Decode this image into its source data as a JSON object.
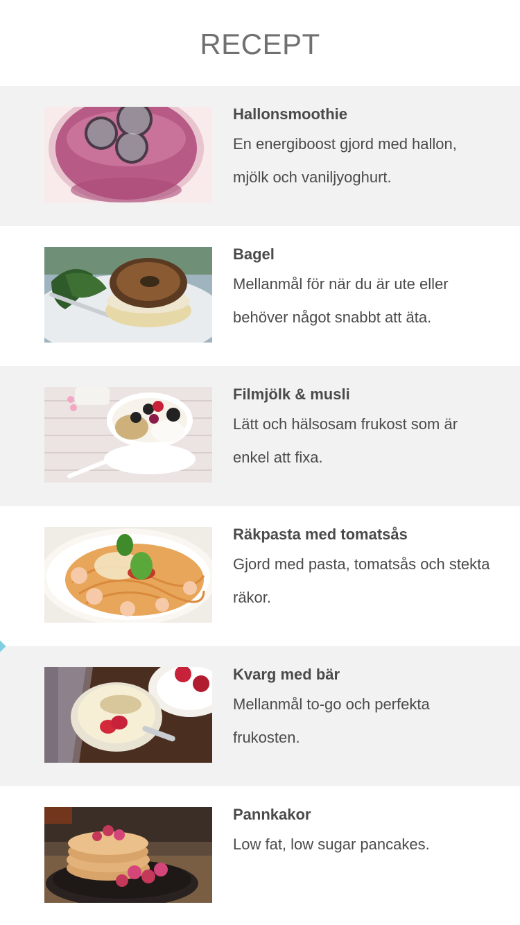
{
  "header": {
    "title": "RECEPT"
  },
  "recipes": [
    {
      "title": "Hallonsmoothie",
      "description": "En energiboost gjord med hallon, mjölk och vaniljyoghurt.",
      "image_icon": "smoothie-photo"
    },
    {
      "title": "Bagel",
      "description": "Mellanmål för när du är ute eller behöver något snabbt att äta.",
      "image_icon": "bagel-photo"
    },
    {
      "title": "Filmjölk & musli",
      "description": "Lätt och hälsosam frukost som är enkel att fixa.",
      "image_icon": "yoghurt-bowl-photo"
    },
    {
      "title": "Räkpasta med tomatsås",
      "description": "Gjord med pasta, tomatsås och stekta räkor.",
      "image_icon": "pasta-photo"
    },
    {
      "title": "Kvarg med bär",
      "description": "Mellanmål to-go och perfekta frukosten.",
      "image_icon": "kvarg-photo"
    },
    {
      "title": "Pannkakor",
      "description": "Low fat, low sugar pancakes.",
      "image_icon": "pancakes-photo"
    }
  ],
  "colors": {
    "row_shaded": "#f2f2f2",
    "row_plain": "#ffffff",
    "text": "#4a4a4a",
    "title": "#707070",
    "marker": "#7fcfe0"
  }
}
